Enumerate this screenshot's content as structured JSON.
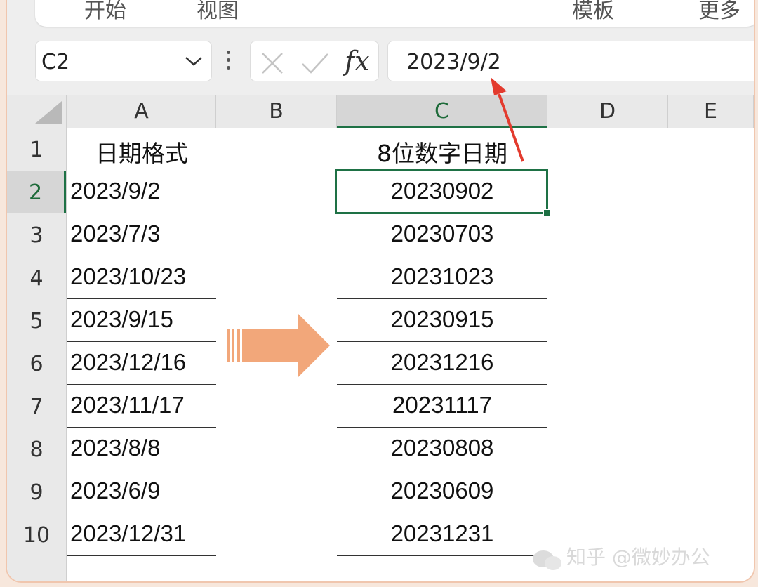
{
  "ribbon": {
    "tabs": [
      "开始",
      "视图",
      "模板",
      "更多"
    ]
  },
  "formula_bar": {
    "name_box": "C2",
    "fx_label": "fx",
    "formula_value": "2023/9/2"
  },
  "columns": [
    "A",
    "B",
    "C",
    "D",
    "E"
  ],
  "active_column": "C",
  "rows": [
    "1",
    "2",
    "3",
    "4",
    "5",
    "6",
    "7",
    "8",
    "9",
    "10"
  ],
  "active_row": "2",
  "column_a": {
    "header": "日期格式",
    "values": [
      "2023/9/2",
      "2023/7/3",
      "2023/10/23",
      "2023/9/15",
      "2023/12/16",
      "2023/11/17",
      "2023/8/8",
      "2023/6/9",
      "2023/12/31"
    ]
  },
  "column_c": {
    "header": "8位数字日期",
    "values": [
      "20230902",
      "20230703",
      "20231023",
      "20230915",
      "20231216",
      "20231117",
      "20230808",
      "20230609",
      "20231231"
    ]
  },
  "selected_cell": "C2",
  "watermark": "知乎 @微妙办公",
  "colors": {
    "accent_green": "#1e7145",
    "arrow_orange": "#f2a77a",
    "pointer_red": "#e33b2e",
    "frame_border": "#f0c6ae"
  }
}
